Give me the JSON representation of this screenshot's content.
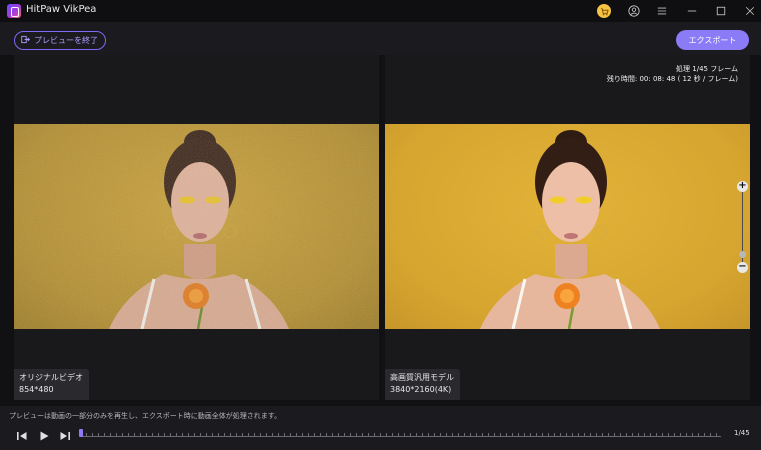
{
  "window": {
    "title": "HitPaw VikPea"
  },
  "toolbar": {
    "exit_label": "プレビューを終了",
    "export_label": "エクスポート"
  },
  "left_panel": {
    "title": "オリジナルビデオ",
    "resolution": "854*480"
  },
  "right_panel": {
    "title": "高画質汎用モデル",
    "resolution": "3840*2160(4K)",
    "processing_line1": "処理 1/45 フレーム",
    "processing_line2": "残り時間: 00: 08: 48 ( 12 秒 / フレーム)"
  },
  "zoom": {
    "plus": "+",
    "minus": "−"
  },
  "footer": {
    "notice": "プレビューは動画の一部分のみを再生し、エクスポート時に動画全体が処理されます。",
    "frame_counter": "1/45"
  },
  "colors": {
    "accent": "#8b7bf7",
    "background": "#111113",
    "panel": "#19191c"
  },
  "icons": [
    "app-logo-icon",
    "cart-icon",
    "user-icon",
    "menu-icon",
    "minimize-icon",
    "maximize-icon",
    "close-icon",
    "exit-icon",
    "previous-frame-icon",
    "play-icon",
    "next-frame-icon"
  ]
}
